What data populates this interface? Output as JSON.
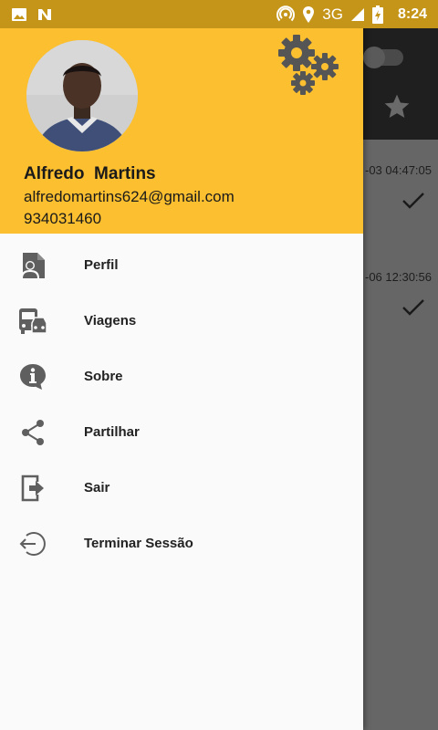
{
  "status_bar": {
    "time": "8:24",
    "network": "3G",
    "icons": [
      "image-icon",
      "n-logo-icon",
      "hotspot-icon",
      "location-icon",
      "signal-icon",
      "battery-charging-icon"
    ]
  },
  "drawer": {
    "user": {
      "name": "Alfredo  Martins",
      "email": "alfredomartins624@gmail.com",
      "phone": "934031460"
    },
    "menu": [
      {
        "label": "Perfil",
        "icon": "profile-document-icon"
      },
      {
        "label": "Viagens",
        "icon": "bus-car-icon"
      },
      {
        "label": "Sobre",
        "icon": "info-bubble-icon"
      },
      {
        "label": "Partilhar",
        "icon": "share-icon"
      },
      {
        "label": "Sair",
        "icon": "exit-icon"
      },
      {
        "label": "Terminar Sessão",
        "icon": "logout-icon"
      }
    ]
  },
  "background": {
    "rows": [
      {
        "date": "-03 04:47:05"
      },
      {
        "date": "-06 12:30:56"
      }
    ]
  },
  "colors": {
    "header": "#fbbf30",
    "status_bar": "#c5951a",
    "icon": "#5f5f5f"
  }
}
